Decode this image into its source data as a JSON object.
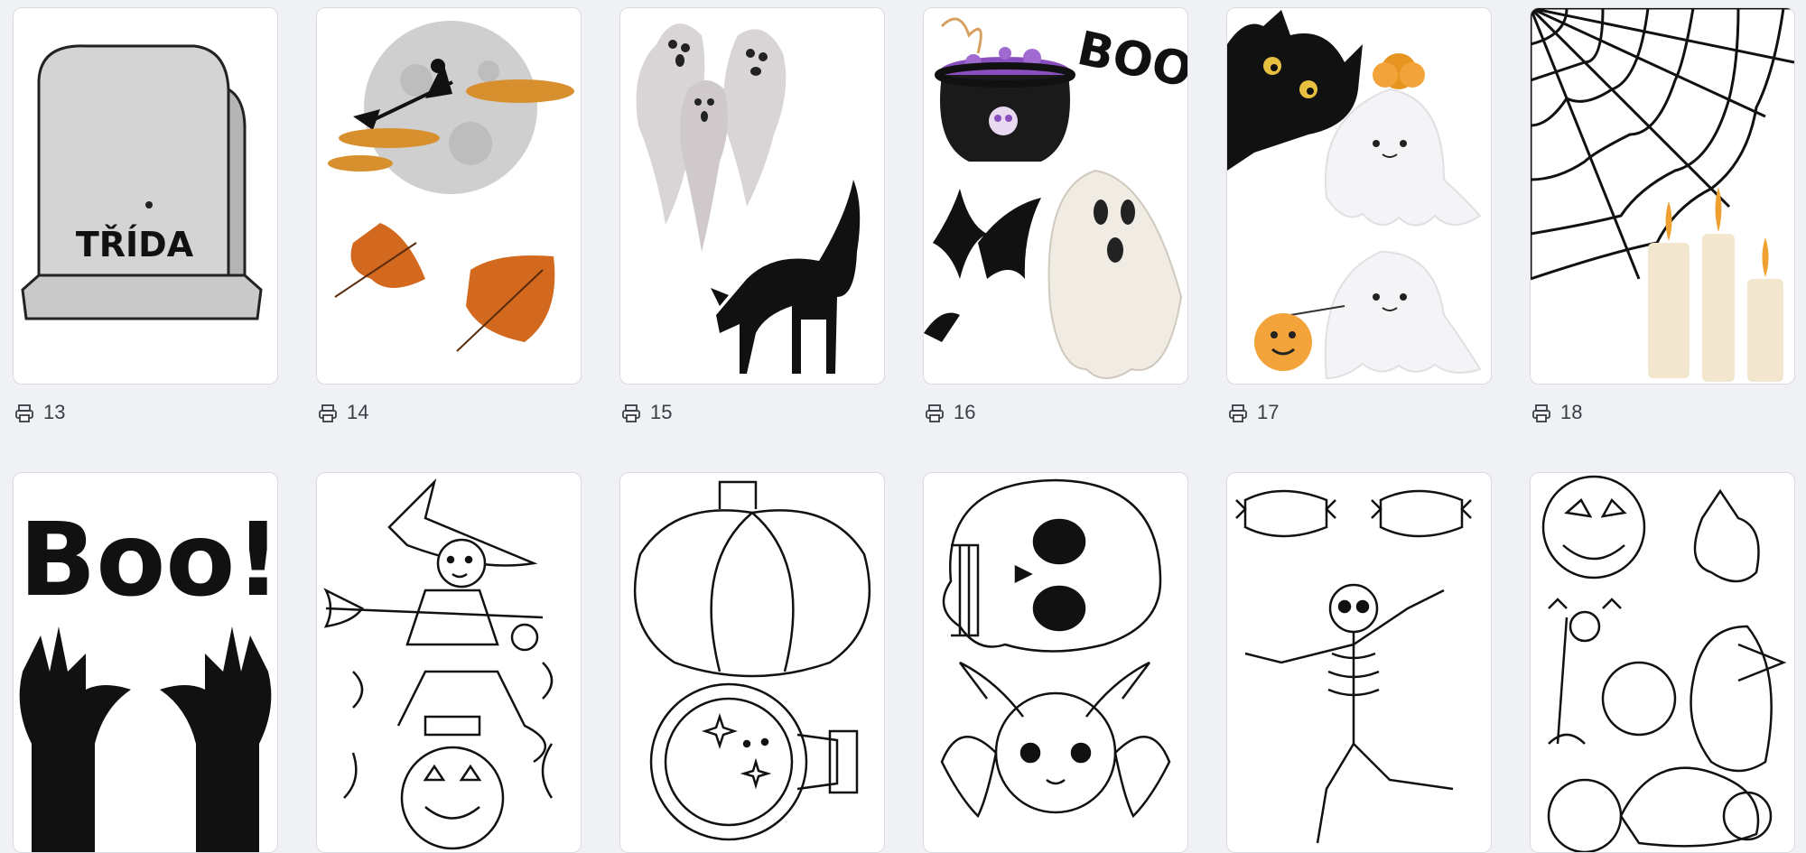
{
  "colors": {
    "background": "#f0f1f5",
    "card": "#ffffff",
    "card_border": "#d9dbe1",
    "caption_text": "#3a3d45",
    "ink": "#111111",
    "leaf_orange": "#d2691e",
    "potion_purple": "#8a4fbf",
    "tombstone_grey": "#d4d4d4"
  },
  "row1": [
    {
      "count": "13",
      "image": "tombstone",
      "label_text": "TŘÍDA"
    },
    {
      "count": "14",
      "image": "moon-witch-autumn-leaves"
    },
    {
      "count": "15",
      "image": "ghosts-black-cat"
    },
    {
      "count": "16",
      "image": "cauldron-boo-bats-ghost",
      "label_text": "BOO!"
    },
    {
      "count": "17",
      "image": "black-cat-cute-ghosts-pumpkins"
    },
    {
      "count": "18",
      "image": "spider-web-candles"
    }
  ],
  "row2": [
    {
      "image": "boo-zombie-hands",
      "label_text": "Boo!"
    },
    {
      "image": "witch-on-broom-coloring"
    },
    {
      "image": "pumpkin-potion-coloring"
    },
    {
      "image": "skull-bat-coloring"
    },
    {
      "image": "candies-skeleton-coloring"
    },
    {
      "image": "halloween-scene-coloring"
    }
  ],
  "icons": {
    "copies": "printer-icon"
  }
}
